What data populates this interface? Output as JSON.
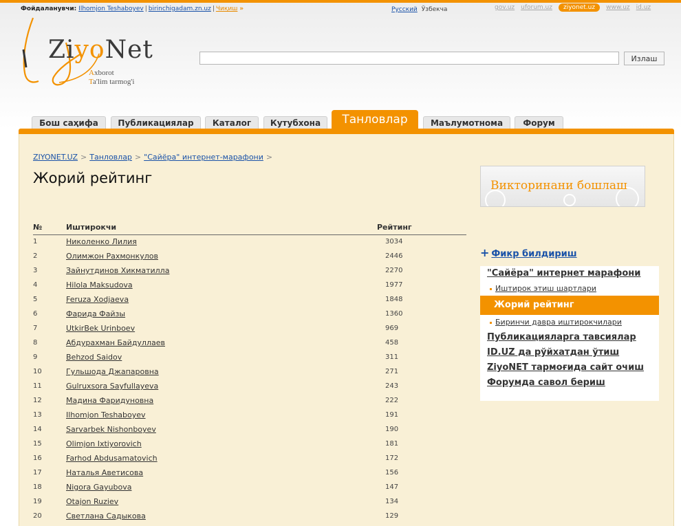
{
  "topbar": {
    "user_label": "Фойдаланувчи:",
    "user_name": "Ilhomjon Teshaboyev",
    "user_site": "birinchigadam.zn.uz",
    "logout": "Чиқиш",
    "logout_arrows": "»",
    "lang_ru": "Русский",
    "lang_uz": "Ўзбекча",
    "sites": [
      "gov.uz",
      "uforum.uz",
      "ziyonet.uz",
      "www.uz",
      "id.uz"
    ],
    "active_site": "ziyonet.uz"
  },
  "logo": {
    "word_start": "Zi",
    "word_y": "y",
    "word_o": "o",
    "word_end": "Net",
    "tag_line1_first": "A",
    "tag_line1_rest": "xborot",
    "tag_line2_first": "T",
    "tag_line2_rest": "a'lim tarmog'i"
  },
  "search": {
    "button": "Излаш",
    "value": ""
  },
  "tabs": [
    {
      "label": "Бош саҳифа"
    },
    {
      "label": "Публикациялар"
    },
    {
      "label": "Каталог"
    },
    {
      "label": "Кутубхона"
    },
    {
      "label": "Танловлар"
    },
    {
      "label": "Маълумотнома"
    },
    {
      "label": "Форум"
    }
  ],
  "active_tab": "Танловлар",
  "breadcrumb": [
    "ZIYONET.UZ",
    "Танловлар",
    "\"Сайёра\" интернет-марафони"
  ],
  "breadcrumb_sep": ">",
  "page_title": "Жорий рейтинг",
  "table": {
    "headers": {
      "num": "№",
      "name": "Иштирокчи",
      "rating": "Рейтинг"
    },
    "rows": [
      {
        "num": "1",
        "name": "Николенко Лилия",
        "rating": "3034"
      },
      {
        "num": "2",
        "name": "Олимжон Рахмонкулов",
        "rating": "2446"
      },
      {
        "num": "3",
        "name": "Зайнутдинов Хикматилла",
        "rating": "2270"
      },
      {
        "num": "4",
        "name": "Hilola Maksudova",
        "rating": "1977"
      },
      {
        "num": "5",
        "name": "Feruza Xodjaeva",
        "rating": "1848"
      },
      {
        "num": "6",
        "name": "Фарида Файзы",
        "rating": "1360"
      },
      {
        "num": "7",
        "name": "UtkirBek Urinboev",
        "rating": "969"
      },
      {
        "num": "8",
        "name": "Абдурахман Байдуллаев",
        "rating": "458"
      },
      {
        "num": "9",
        "name": "Behzod Saidov",
        "rating": "311"
      },
      {
        "num": "10",
        "name": "Гульшода Джапаровна",
        "rating": "271"
      },
      {
        "num": "11",
        "name": "Gulruxsora Sayfullayeva",
        "rating": "243"
      },
      {
        "num": "12",
        "name": "Мадина Фаридуновна",
        "rating": "222"
      },
      {
        "num": "13",
        "name": "Ilhomjon Teshaboyev",
        "rating": "191"
      },
      {
        "num": "14",
        "name": "Sarvarbek Nishonboyev",
        "rating": "190"
      },
      {
        "num": "15",
        "name": "Olimjon Ixtiyorovich",
        "rating": "181"
      },
      {
        "num": "16",
        "name": "Farhod Abdusamatovich",
        "rating": "172"
      },
      {
        "num": "17",
        "name": "Наталья Аветисова",
        "rating": "156"
      },
      {
        "num": "18",
        "name": "Nigora Gayubova",
        "rating": "147"
      },
      {
        "num": "19",
        "name": "Otajon Ruziev",
        "rating": "134"
      },
      {
        "num": "20",
        "name": "Светлана Садыкова",
        "rating": "129"
      }
    ]
  },
  "sidebar": {
    "banner": "Викторинани бошлаш",
    "feedback_icon": "+",
    "feedback": "Фикр билдириш",
    "menu": {
      "marathon": "\"Сайёра\" интернет марафони",
      "rules": "Иштирок этиш шартлари",
      "current": "Жорий рейтинг",
      "first_round": "Биринчи давра иштирокчилари",
      "publications": "Публикацияларга тавсиялар",
      "id_register": "ID.UZ да рўйхатдан ўтиш",
      "open_site": "ZiyoNET тармоғида сайт очиш",
      "forum_ask": "Форумда савол бериш"
    }
  },
  "colors": {
    "accent": "#f39200",
    "link": "#1a52a8",
    "content_bg": "#f9f0d6"
  }
}
